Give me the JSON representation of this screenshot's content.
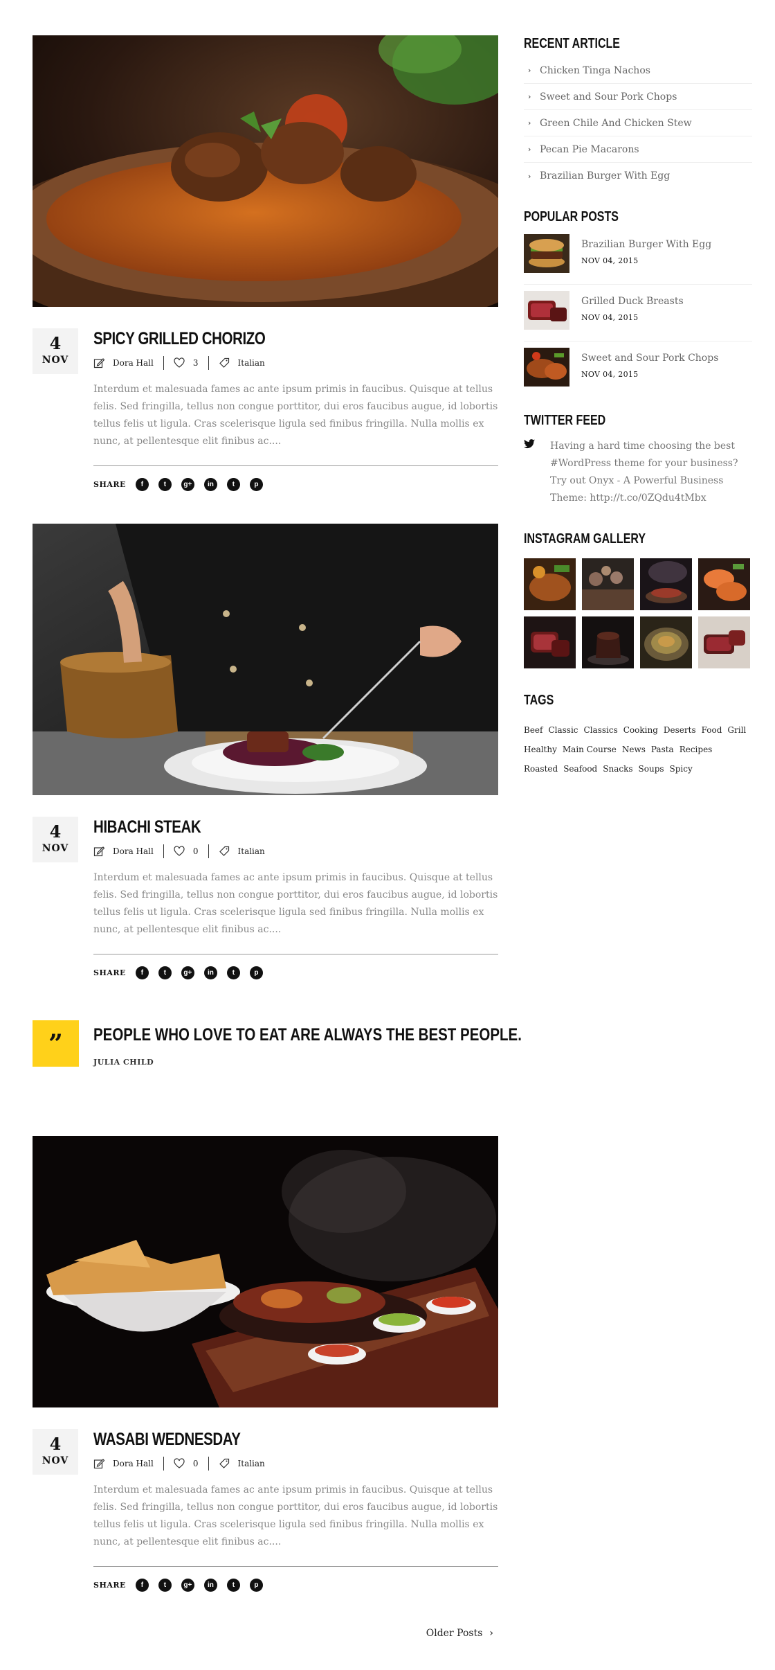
{
  "posts": [
    {
      "id": "post1",
      "image_desc": "food-photo-meatballs",
      "date_day": "4",
      "date_month": "NOV",
      "title": "SPICY GRILLED CHORIZO",
      "author": "Dora Hall",
      "likes": "3",
      "category": "Italian",
      "excerpt": "Interdum et malesuada fames ac ante ipsum primis in faucibus. Quisque at tellus felis. Sed fringilla, tellus non congue porttitor, dui eros faucibus augue, id lobortis tellus felis ut ligula. Cras scelerisque ligula sed finibus fringilla. Nulla mollis ex nunc, at pellentesque elit finibus ac....",
      "share_label": "SHARE"
    },
    {
      "id": "post2",
      "image_desc": "food-photo-chef-plating",
      "date_day": "4",
      "date_month": "NOV",
      "title": "HIBACHI STEAK",
      "author": "Dora Hall",
      "likes": "0",
      "category": "Italian",
      "excerpt": "Interdum et malesuada fames ac ante ipsum primis in faucibus. Quisque at tellus felis. Sed fringilla, tellus non congue porttitor, dui eros faucibus augue, id lobortis tellus felis ut ligula. Cras scelerisque ligula sed finibus fringilla. Nulla mollis ex nunc, at pellentesque elit finibus ac....",
      "share_label": "SHARE"
    },
    {
      "id": "post3",
      "image_desc": "food-photo-fajitas",
      "date_day": "4",
      "date_month": "NOV",
      "title": "WASABI WEDNESDAY",
      "author": "Dora Hall",
      "likes": "0",
      "category": "Italian",
      "excerpt": "Interdum et malesuada fames ac ante ipsum primis in faucibus. Quisque at tellus felis. Sed fringilla, tellus non congue porttitor, dui eros faucibus augue, id lobortis tellus felis ut ligula. Cras scelerisque ligula sed finibus fringilla. Nulla mollis ex nunc, at pellentesque elit finibus ac....",
      "share_label": "SHARE"
    }
  ],
  "quote": {
    "mark": "”",
    "text": "PEOPLE WHO LOVE TO EAT ARE ALWAYS THE BEST PEOPLE.",
    "author": "JULIA CHILD",
    "accent_color": "#ffd11a"
  },
  "pagination": {
    "older_label": "Older Posts"
  },
  "sidebar": {
    "recent_title": "RECENT ARTICLE",
    "recent": [
      "Chicken Tinga Nachos",
      "Sweet and Sour Pork Chops",
      "Green Chile And Chicken Stew",
      "Pecan Pie Macarons",
      "Brazilian Burger With Egg"
    ],
    "popular_title": "POPULAR POSTS",
    "popular": [
      {
        "title": "Brazilian Burger With Egg",
        "date": "NOV 04, 2015"
      },
      {
        "title": "Grilled Duck Breasts",
        "date": "NOV 04, 2015"
      },
      {
        "title": "Sweet and Sour Pork Chops",
        "date": "NOV 04, 2015"
      }
    ],
    "twitter_title": "TWITTER FEED",
    "tweet": "Having a hard time choosing the best #WordPress theme for your business? Try out Onyx - A Powerful Business Theme: http://t.co/0ZQdu4tMbx",
    "instagram_title": "INSTAGRAM GALLERY",
    "tags_title": "TAGS",
    "tags": [
      "Beef",
      "Classic",
      "Classics",
      "Cooking",
      "Deserts",
      "Food",
      "Grill",
      "Healthy",
      "Main Course",
      "News",
      "Pasta",
      "Recipes",
      "Roasted",
      "Seafood",
      "Snacks",
      "Soups",
      "Spicy"
    ]
  },
  "icons": {
    "author": "edit-icon",
    "likes": "heart-icon",
    "category": "tag-icon",
    "share": [
      "facebook-icon",
      "twitter-icon",
      "google-plus-icon",
      "linkedin-icon",
      "tumblr-icon",
      "pinterest-icon"
    ],
    "share_glyphs": [
      "f",
      "t",
      "g+",
      "in",
      "t",
      "p"
    ]
  }
}
